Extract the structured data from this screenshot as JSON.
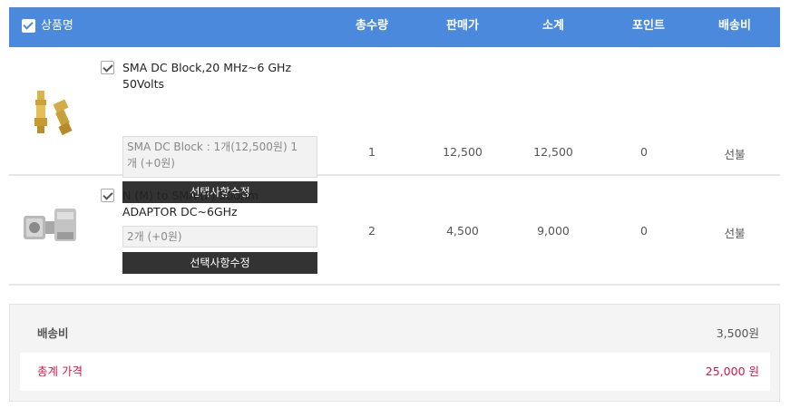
{
  "header": {
    "product_name": "상품명",
    "total_qty": "총수량",
    "sale_price": "판매가",
    "subtotal": "소계",
    "point": "포인트",
    "shipping": "배송비"
  },
  "items": [
    {
      "name_line1": "SMA DC Block,20 MHz~6 GHz",
      "name_line2": "50Volts",
      "option_line1": "SMA DC Block : 1개(12,500원) 1",
      "option_line2": "개 (+0원)",
      "option_button": "선택사항수정",
      "qty": "1",
      "price": "12,500",
      "subtotal": "12,500",
      "point": "0",
      "shipping": "선불"
    },
    {
      "name_line1": "N (M) to SMA (F) 50ohm",
      "name_line2": "ADAPTOR DC~6GHz",
      "option_line1": "2개 (+0원)",
      "option_button": "선택사항수정",
      "qty": "2",
      "price": "4,500",
      "subtotal": "9,000",
      "point": "0",
      "shipping": "선불"
    }
  ],
  "summary": {
    "shipping_label": "배송비",
    "shipping_value": "3,500원",
    "total_label": "총계 가격",
    "total_value": "25,000 원"
  },
  "colors": {
    "header_bg": "#4a89dc",
    "total_red": "#d6174a",
    "button_dark": "#333333"
  }
}
